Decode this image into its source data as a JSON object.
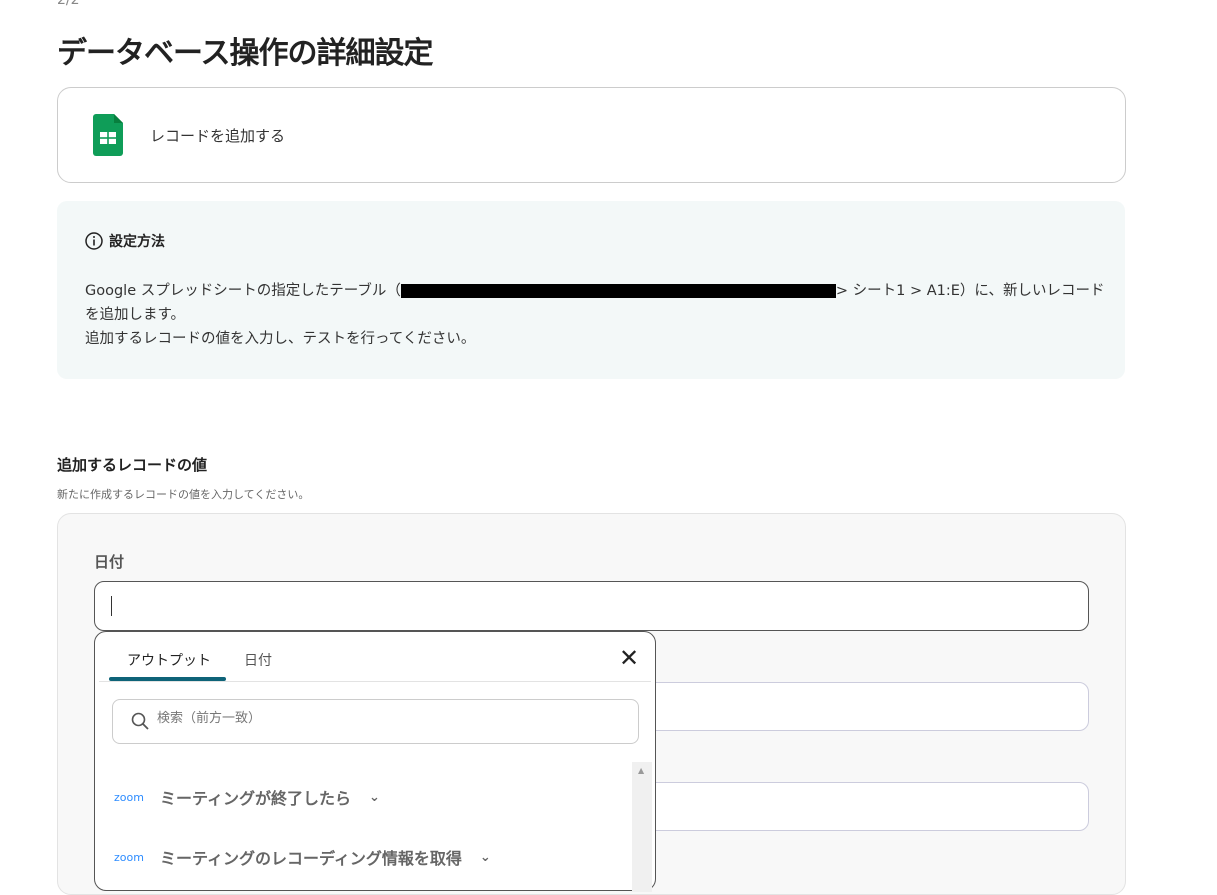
{
  "step": "2/2",
  "title": "データベース操作の詳細設定",
  "action": {
    "icon": "google-sheets-icon",
    "label": "レコードを追加する"
  },
  "info": {
    "heading": "設定方法",
    "line1a": "Google スプレッドシートの指定したテーブル（",
    "line1b": "> シート1 > A1:E）に、新しいレコードを追加します。",
    "line2": "追加するレコードの値を入力し、テストを行ってください。"
  },
  "section": {
    "label": "追加するレコードの値",
    "help": "新たに作成するレコードの値を入力してください。"
  },
  "field": {
    "label": "日付",
    "value": ""
  },
  "dropdown": {
    "tabs": [
      "アウトプット",
      "日付"
    ],
    "search_placeholder": "検索（前方一致）",
    "items": [
      {
        "app": "zoom",
        "label": "ミーティングが終了したら"
      },
      {
        "app": "zoom",
        "label": "ミーティングのレコーディング情報を取得"
      }
    ]
  },
  "colors": {
    "accent": "#0e6378",
    "info_bg": "#f3f8f8",
    "sheets": "#0f9d58"
  }
}
